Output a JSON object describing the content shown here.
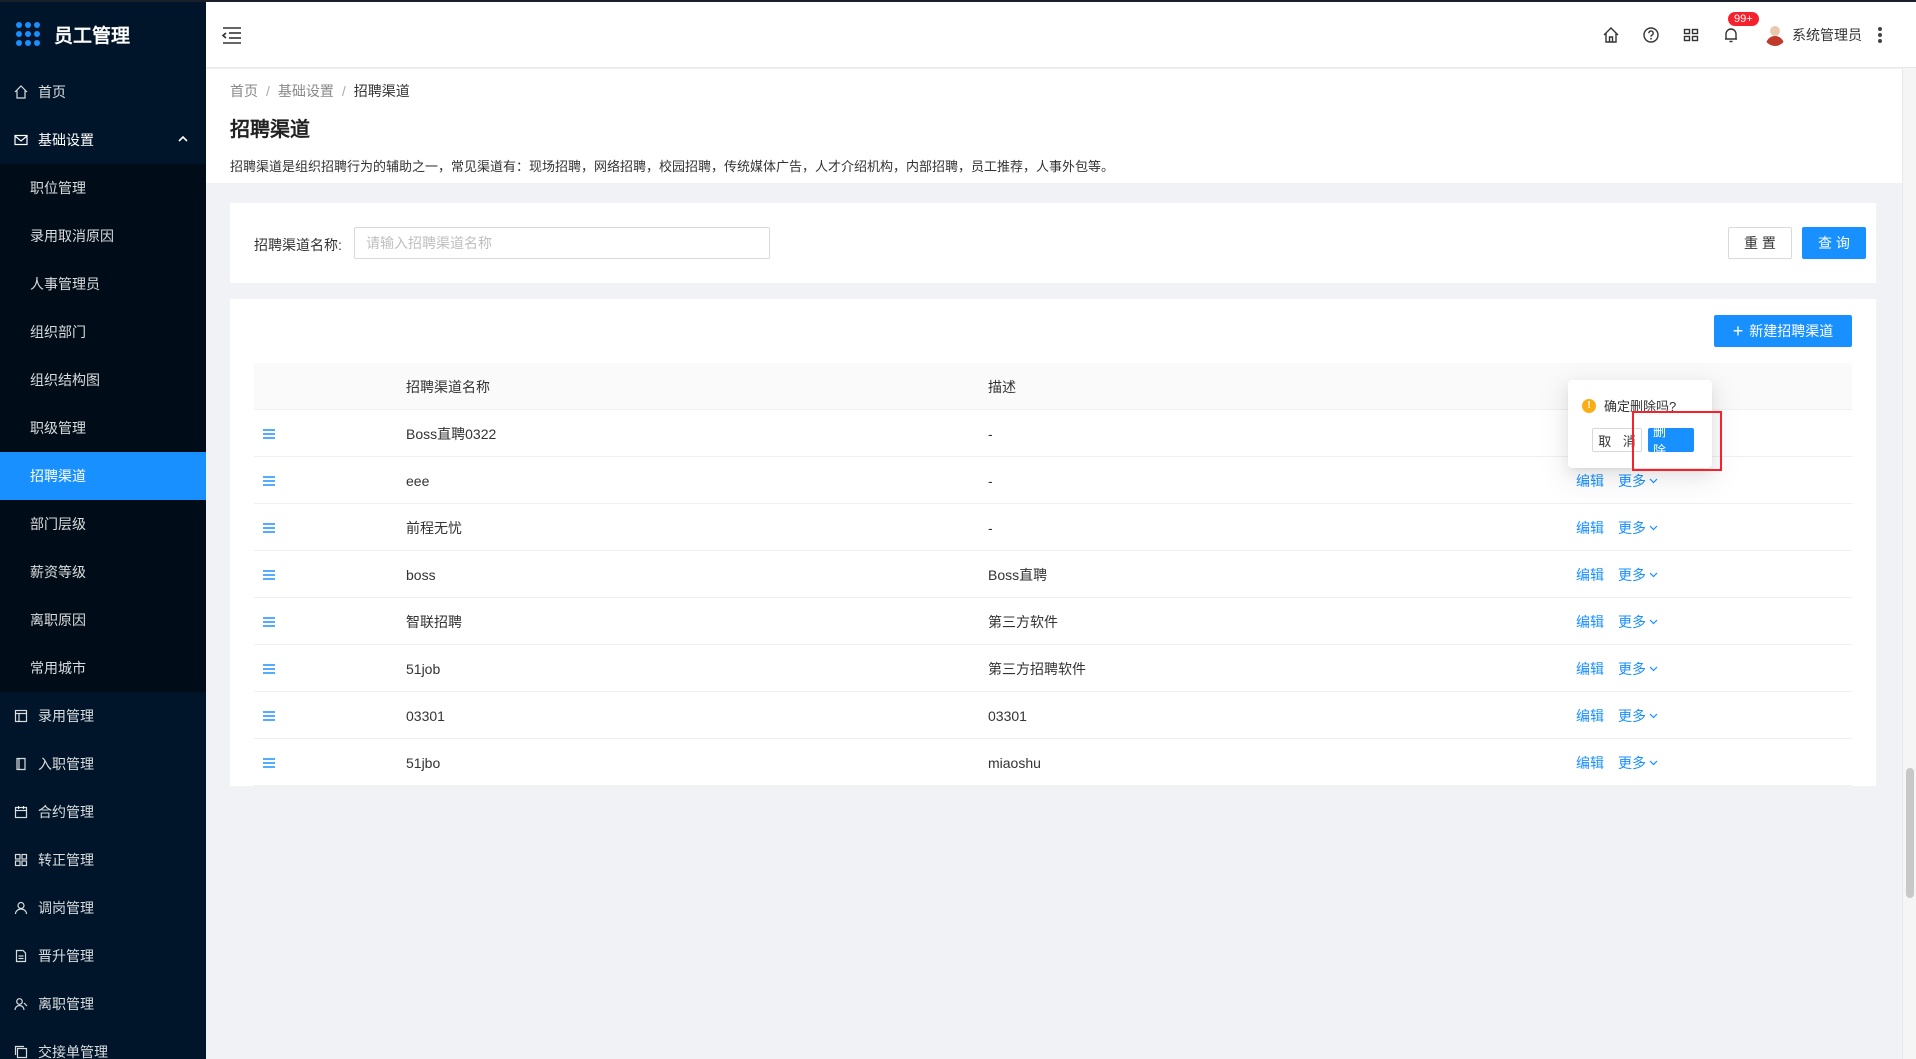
{
  "app": {
    "title": "员工管理"
  },
  "sidebar": {
    "top_items": [
      {
        "label": "首页",
        "icon": "home-icon"
      },
      {
        "label": "基础设置",
        "icon": "mail-icon",
        "open": true
      }
    ],
    "submenu": [
      {
        "label": "职位管理"
      },
      {
        "label": "录用取消原因"
      },
      {
        "label": "人事管理员"
      },
      {
        "label": "组织部门"
      },
      {
        "label": "组织结构图"
      },
      {
        "label": "职级管理"
      },
      {
        "label": "招聘渠道",
        "active": true
      },
      {
        "label": "部门层级"
      },
      {
        "label": "薪资等级"
      },
      {
        "label": "离职原因"
      },
      {
        "label": "常用城市"
      }
    ],
    "bottom_items": [
      {
        "label": "录用管理",
        "icon": "layout-icon"
      },
      {
        "label": "入职管理",
        "icon": "book-icon"
      },
      {
        "label": "合约管理",
        "icon": "calendar-icon"
      },
      {
        "label": "转正管理",
        "icon": "grid-icon"
      },
      {
        "label": "调岗管理",
        "icon": "user-icon"
      },
      {
        "label": "晋升管理",
        "icon": "file-icon"
      },
      {
        "label": "离职管理",
        "icon": "user-minus-icon"
      },
      {
        "label": "交接单管理",
        "icon": "copy-icon"
      }
    ]
  },
  "header": {
    "badge": "99+",
    "user_name": "系统管理员"
  },
  "page": {
    "breadcrumb": [
      "首页",
      "基础设置",
      "招聘渠道"
    ],
    "title": "招聘渠道",
    "description": "招聘渠道是组织招聘行为的辅助之一，常见渠道有：现场招聘，网络招聘，校园招聘，传统媒体广告，人才介绍机构，内部招聘，员工推荐，人事外包等。"
  },
  "search": {
    "label": "招聘渠道名称:",
    "placeholder": "请输入招聘渠道名称",
    "value": "",
    "reset_label": "重 置",
    "query_label": "查 询"
  },
  "table": {
    "new_button": "新建招聘渠道",
    "columns": [
      "招聘渠道名称",
      "描述"
    ],
    "edit_label": "编辑",
    "more_label": "更多",
    "rows": [
      {
        "name": "Boss直聘0322",
        "desc": "-"
      },
      {
        "name": "eee",
        "desc": "-"
      },
      {
        "name": "前程无忧",
        "desc": "-"
      },
      {
        "name": "boss",
        "desc": "Boss直聘"
      },
      {
        "name": "智联招聘",
        "desc": "第三方软件"
      },
      {
        "name": "51job",
        "desc": "第三方招聘软件"
      },
      {
        "name": "03301",
        "desc": "03301"
      },
      {
        "name": "51jbo",
        "desc": "miaoshu"
      }
    ]
  },
  "popconfirm": {
    "title": "确定删除吗?",
    "cancel": "取 消",
    "confirm": "删 除"
  },
  "colors": {
    "sidebar_bg": "#001529",
    "primary": "#1890ff",
    "danger": "#f5222d",
    "warning": "#faad14"
  }
}
